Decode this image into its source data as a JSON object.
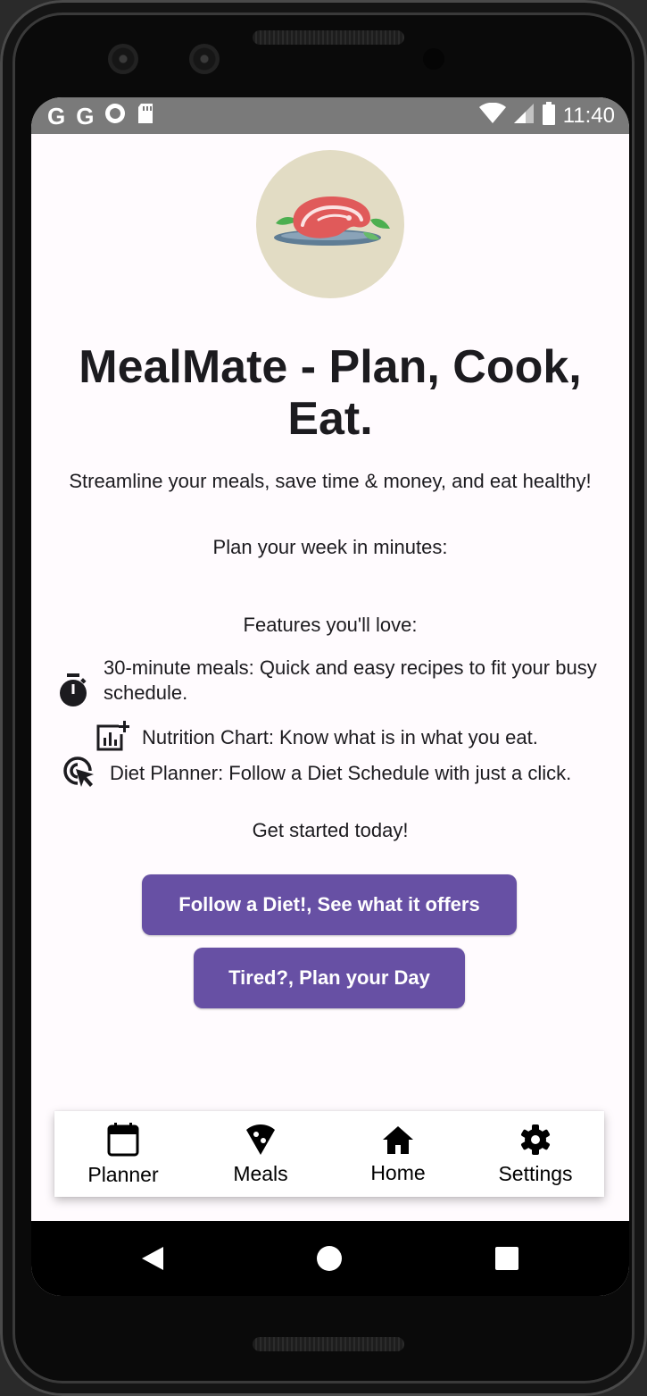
{
  "status_bar": {
    "left_icons": [
      "G",
      "G"
    ],
    "time": "11:40"
  },
  "app": {
    "title": "MealMate - Plan, Cook, Eat.",
    "tagline": "Streamline your meals, save time & money, and eat healthy!",
    "plan_text": "Plan your week in minutes:",
    "features_heading": "Features you'll love:",
    "features": [
      {
        "icon": "timer-icon",
        "text": "30-minute meals: Quick and easy recipes to fit your busy schedule."
      },
      {
        "icon": "chart-add-icon",
        "text": "Nutrition Chart: Know what is in what you eat."
      },
      {
        "icon": "click-cursor-icon",
        "text": "Diet Planner: Follow a Diet Schedule with just a click."
      }
    ],
    "cta_text": "Get started today!",
    "buttons": {
      "follow_diet": "Follow a Diet!, See what it offers",
      "plan_day": "Tired?, Plan your Day"
    }
  },
  "bottom_nav": [
    {
      "icon": "calendar-icon",
      "label": "Planner"
    },
    {
      "icon": "pizza-icon",
      "label": "Meals"
    },
    {
      "icon": "home-icon",
      "label": "Home"
    },
    {
      "icon": "gear-icon",
      "label": "Settings"
    }
  ],
  "colors": {
    "primary": "#6750a4",
    "background": "#fffbfe",
    "logo_bg": "#e2dcc4",
    "status_bar": "#7a7a7a"
  }
}
